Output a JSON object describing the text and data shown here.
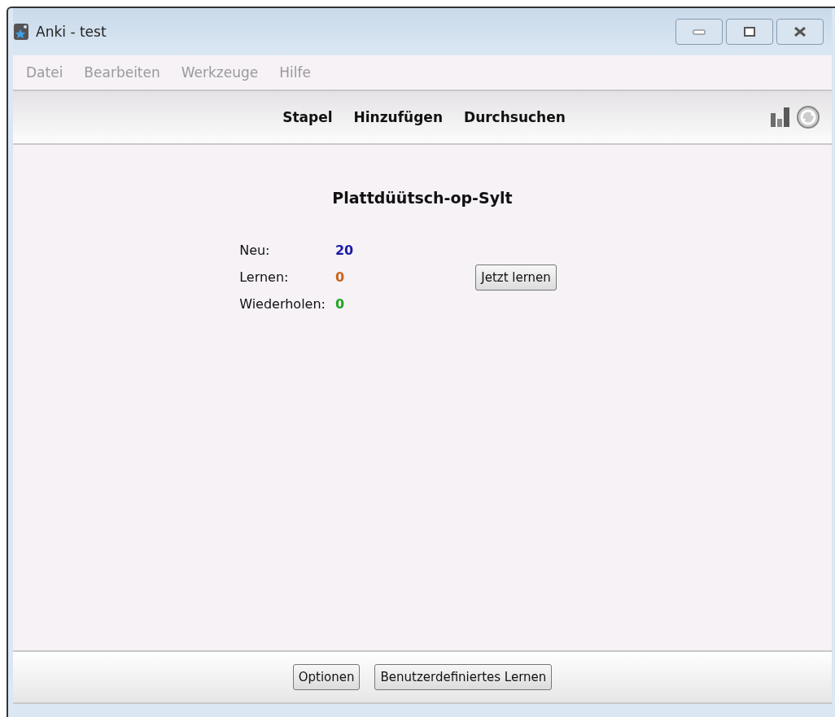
{
  "window": {
    "title": "Anki - test"
  },
  "menu": [
    "Datei",
    "Bearbeiten",
    "Werkzeuge",
    "Hilfe"
  ],
  "toolbar": [
    "Stapel",
    "Hinzufügen",
    "Durchsuchen"
  ],
  "deck": {
    "title": "Plattdüütsch-op-Sylt",
    "counts": [
      {
        "label": "Neu:",
        "value": "20",
        "color": "#1a1aa6"
      },
      {
        "label": "Lernen:",
        "value": "0",
        "color": "#c8631a"
      },
      {
        "label": "Wiederholen:",
        "value": "0",
        "color": "#1ea61e"
      }
    ],
    "study_button": "Jetzt lernen"
  },
  "bottom_buttons": [
    "Optionen",
    "Benutzerdefiniertes Lernen"
  ]
}
